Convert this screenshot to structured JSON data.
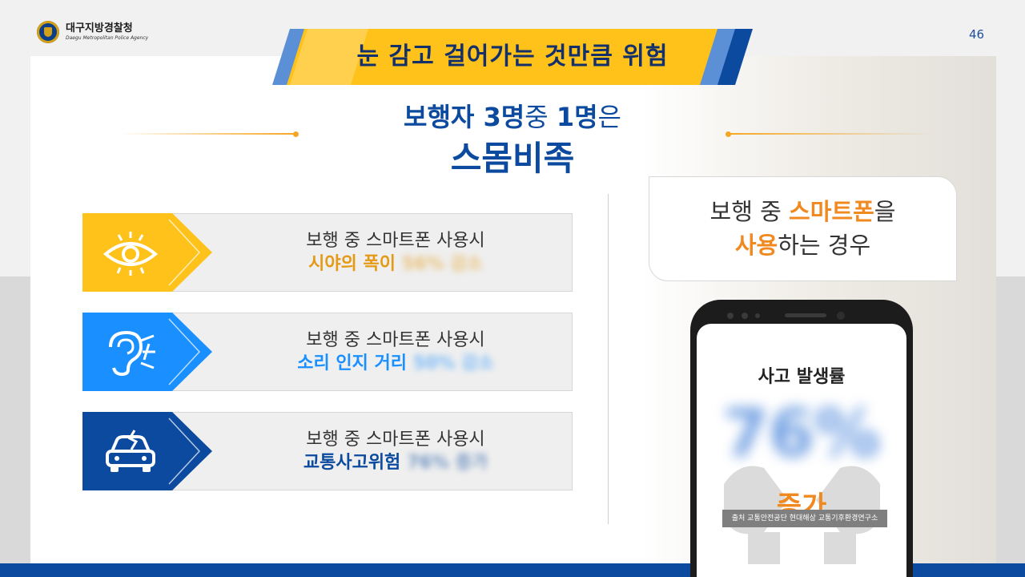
{
  "header": {
    "org_name": "대구지방경찰청",
    "org_name_en": "Daegu Metropolitan Police Agency",
    "page_number": "46",
    "banner_title": "눈 감고 걸어가는 것만큼 위험"
  },
  "headline": {
    "line1_part1": "보행자 3명",
    "line1_part2": "중 ",
    "line1_part3": "1명",
    "line1_part4": "은",
    "line2": "스몸비족"
  },
  "stats": [
    {
      "line1": "보행 중 스마트폰 사용시",
      "line2": "시야의 폭이",
      "value": "56% 감소",
      "icon": "eye-icon",
      "color": "#f0a419"
    },
    {
      "line1": "보행 중 스마트폰 사용시",
      "line2": "소리 인지 거리",
      "value": "50% 감소",
      "icon": "hearing-icon",
      "color": "#1a8fff"
    },
    {
      "line1": "보행 중 스마트폰 사용시",
      "line2": "교통사고위험",
      "value": "76% 증가",
      "icon": "car-crash-icon",
      "color": "#0b4a9e"
    }
  ],
  "case_box": {
    "line1_a": "보행 중 ",
    "line1_b": "스마트폰",
    "line1_c": "을",
    "line2_a": "사용",
    "line2_b": "하는 경우"
  },
  "phone": {
    "title": "사고 발생률",
    "value": "76%",
    "change": "증가",
    "source": "출처 교통안전공단  현대해상 교통기후환경연구소"
  }
}
